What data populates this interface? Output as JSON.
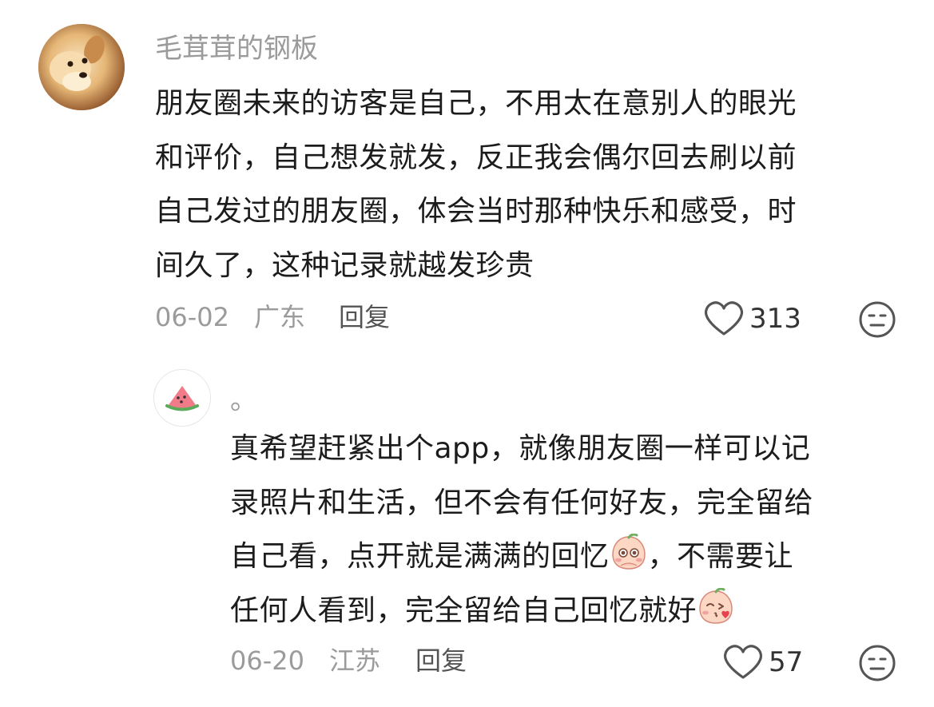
{
  "comment": {
    "username": "毛茸茸的钢板",
    "lines": [
      "朋友圈未来的访客是自己，不用太在意别人的眼光",
      "和评价，自己想发就发，反正我会偶尔回去刷以前",
      "自己发过的朋友圈，体会当时那种快乐和感受，时",
      "间久了，这种记录就越发珍贵"
    ],
    "date": "06-02",
    "location": "广东",
    "reply_label": "回复",
    "likes": "313"
  },
  "reply": {
    "username": "。",
    "lines": [
      "真希望赶紧出个app，就像朋友圈一样可以记",
      "录照片和生活，但不会有任何好友，完全留给",
      "自己看，点开就是满满的回忆",
      "，不需要让",
      "任何人看到，完全留给自己回忆就好"
    ],
    "date": "06-20",
    "location": "江苏",
    "reply_label": "回复",
    "likes": "57"
  },
  "icons": {
    "heart": "heart-outline-icon",
    "dislike": "unamused-face-icon",
    "emoji1": "peach-teary-eyes-emoji",
    "emoji2": "peach-kiss-emoji",
    "avatar_reply": "watermelon-icon"
  },
  "colors": {
    "text": "#1c1c1c",
    "muted": "#9b9b9b",
    "icon": "#555555"
  }
}
